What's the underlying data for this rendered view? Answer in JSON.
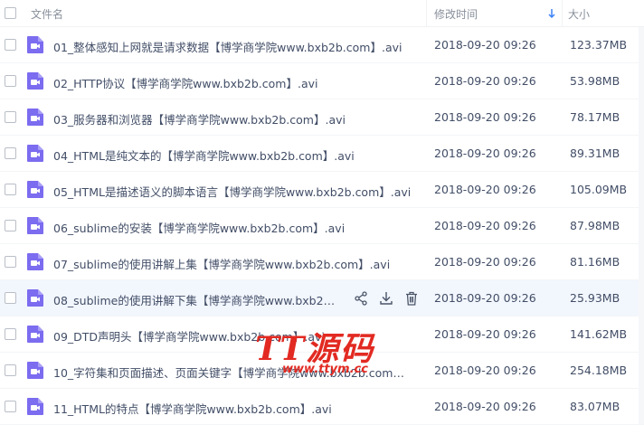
{
  "header": {
    "name_label": "文件名",
    "time_label": "修改时间",
    "size_label": "大小"
  },
  "colors": {
    "video_icon": "#7b6cf0",
    "accent": "#3b82f6",
    "watermark": "#e22a22"
  },
  "files": [
    {
      "name": "01_整体感知上网就是请求数据【博学商学院www.bxb2b.com】.avi",
      "time": "2018-09-20 09:26",
      "size": "123.37MB"
    },
    {
      "name": "02_HTTP协议【博学商学院www.bxb2b.com】.avi",
      "time": "2018-09-20 09:26",
      "size": "53.98MB"
    },
    {
      "name": "03_服务器和浏览器【博学商学院www.bxb2b.com】.avi",
      "time": "2018-09-20 09:26",
      "size": "78.17MB"
    },
    {
      "name": "04_HTML是纯文本的【博学商学院www.bxb2b.com】.avi",
      "time": "2018-09-20 09:26",
      "size": "89.31MB"
    },
    {
      "name": "05_HTML是描述语义的脚本语言【博学商学院www.bxb2b.com】.avi",
      "time": "2018-09-20 09:26",
      "size": "105.09MB"
    },
    {
      "name": "06_sublime的安装【博学商学院www.bxb2b.com】.avi",
      "time": "2018-09-20 09:26",
      "size": "87.98MB"
    },
    {
      "name": "07_sublime的使用讲解上集【博学商学院www.bxb2b.com】.avi",
      "time": "2018-09-20 09:26",
      "size": "81.16MB"
    },
    {
      "name": "08_sublime的使用讲解下集【博学商学院www.bxb2b.co...",
      "time": "2018-09-20 09:26",
      "size": "25.93MB"
    },
    {
      "name": "09_DTD声明头【博学商学院www.bxb2b.com】.avi",
      "time": "2018-09-20 09:26",
      "size": "141.62MB"
    },
    {
      "name": "10_字符集和页面描述、页面关键字【博学商学院www.bxb2b.com】.avi",
      "time": "2018-09-20 09:26",
      "size": "254.18MB"
    },
    {
      "name": "11_HTML的特点【博学商学院www.bxb2b.com】.avi",
      "time": "2018-09-20 09:26",
      "size": "83.07MB"
    }
  ],
  "watermark": {
    "main": "TT源码",
    "sub": "www.ttym.cc"
  }
}
